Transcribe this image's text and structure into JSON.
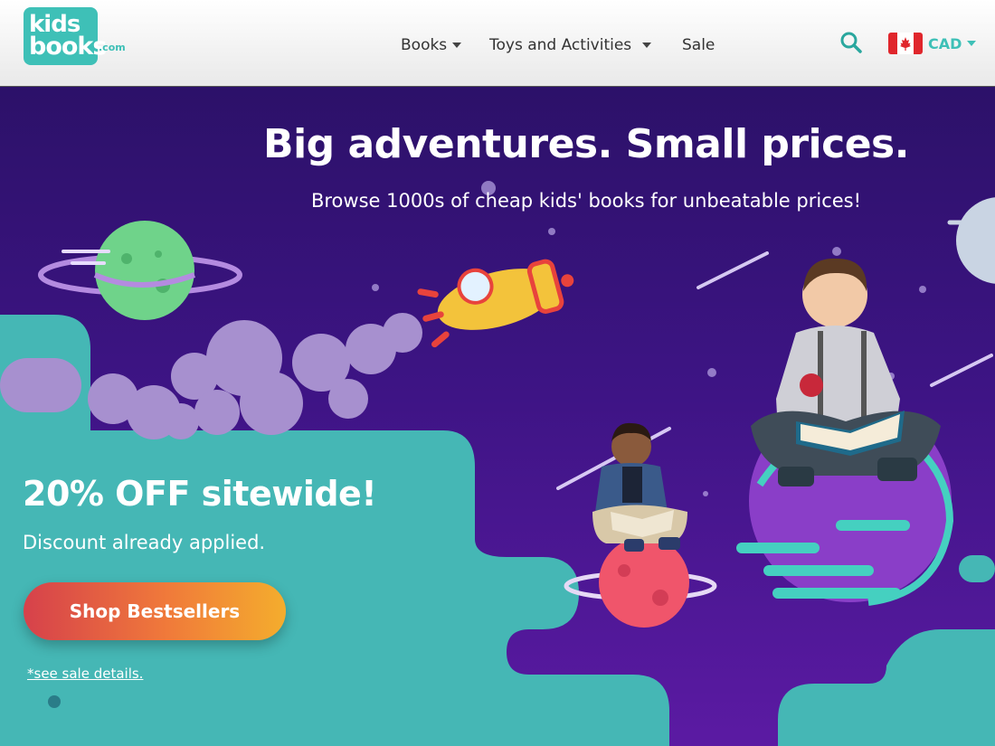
{
  "header": {
    "logo": {
      "line1": "kids",
      "line2": "books",
      "suffix": ".com"
    },
    "nav": [
      {
        "label": "Books",
        "has_dropdown": true
      },
      {
        "label": "Toys and Activities",
        "has_dropdown": true
      },
      {
        "label": "Sale",
        "has_dropdown": false
      }
    ],
    "search_icon": "search-icon",
    "currency": {
      "flag": "canada-flag-icon",
      "code": "CAD"
    }
  },
  "hero": {
    "headline": "Big adventures. Small prices.",
    "subheadline": "Browse 1000s of cheap kids' books for unbeatable prices!",
    "promo_title": "20% OFF sitewide!",
    "promo_subtitle": "Discount already applied.",
    "cta_label": "Shop Bestsellers",
    "sale_details_link": "*see sale details."
  },
  "colors": {
    "brand_teal": "#3ec0b7",
    "hero_purple": "#3d1484",
    "cta_gradient_start": "#d6414b",
    "cta_gradient_end": "#f4ad2d"
  }
}
